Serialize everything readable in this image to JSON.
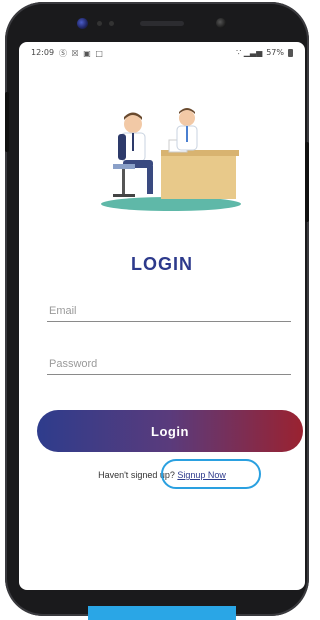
{
  "status_bar": {
    "time": "12:09",
    "left_icons": "Ⓢ ☒ ▣ □",
    "signal": "∵ ▁▃▅",
    "battery_percent": "57%"
  },
  "screen": {
    "title": "LOGIN",
    "email": {
      "placeholder": "Email",
      "value": ""
    },
    "password": {
      "placeholder": "Password",
      "value": ""
    },
    "login_button_label": "Login",
    "signup_prompt": "Haven't signed up?",
    "signup_link": "Signup Now"
  },
  "colors": {
    "title": "#2d3a8c",
    "button_gradient_start": "#2e3c8c",
    "button_gradient_end": "#9a2230",
    "highlight": "#2aa0e0"
  }
}
